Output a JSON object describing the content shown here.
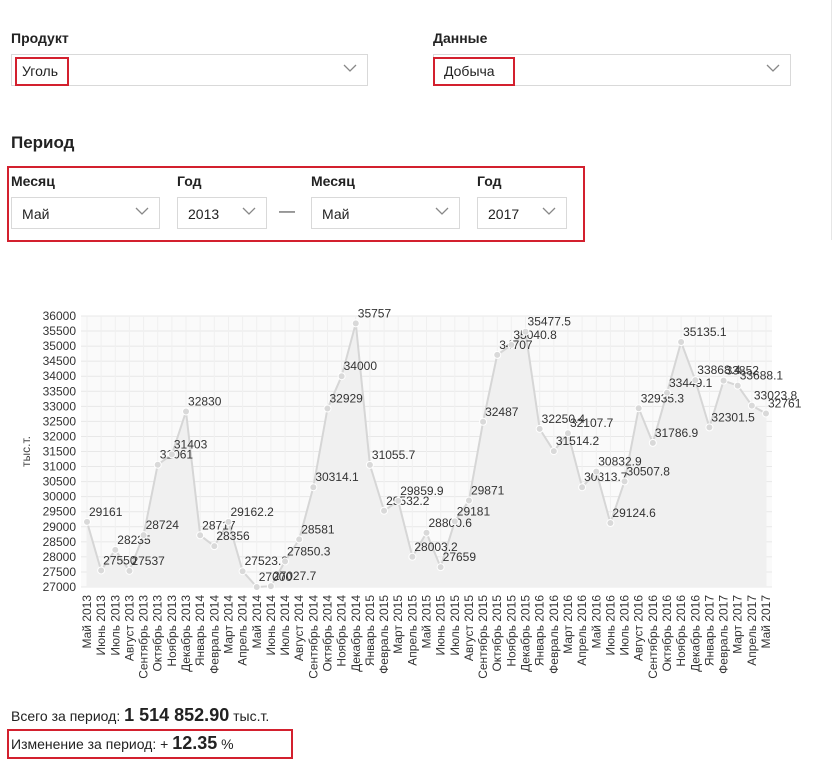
{
  "filters": {
    "product_label": "Продукт",
    "product_value": "Уголь",
    "data_label": "Данные",
    "data_value": "Добыча"
  },
  "period": {
    "title": "Период",
    "month_label": "Месяц",
    "year_label": "Год",
    "from_month": "Май",
    "from_year": "2013",
    "separator": "—",
    "to_month": "Май",
    "to_year": "2017"
  },
  "summary": {
    "total_label": "Всего за период:",
    "total_value": "1 514 852.90",
    "total_unit": "тыс.т.",
    "change_label": "Изменение за период:",
    "change_sign": "+",
    "change_value": "12.35",
    "change_unit": "%"
  },
  "colors": {
    "highlight": "#d3202e",
    "line": "#d6d6d6",
    "area": "#f0f0f0",
    "point": "#d9d9d9",
    "grid": "#e8e8e8"
  },
  "chart_data": {
    "type": "area",
    "ylabel": "тыс.т.",
    "ylim": [
      27000,
      36000
    ],
    "yticks": [
      27000,
      27500,
      28000,
      28500,
      29000,
      29500,
      30000,
      30500,
      31000,
      31500,
      32000,
      32500,
      33000,
      33500,
      34000,
      34500,
      35000,
      35500,
      36000
    ],
    "grid": true,
    "categories": [
      "Май 2013",
      "Июнь 2013",
      "Июль 2013",
      "Август 2013",
      "Сентябрь 2013",
      "Октябрь 2013",
      "Ноябрь 2013",
      "Декабрь 2013",
      "Январь 2014",
      "Февраль 2014",
      "Март 2014",
      "Апрель 2014",
      "Май 2014",
      "Июнь 2014",
      "Июль 2014",
      "Август 2014",
      "Сентябрь 2014",
      "Октябрь 2014",
      "Ноябрь 2014",
      "Декабрь 2014",
      "Январь 2015",
      "Февраль 2015",
      "Март 2015",
      "Апрель 2015",
      "Май 2015",
      "Июнь 2015",
      "Июль 2015",
      "Август 2015",
      "Сентябрь 2015",
      "Октябрь 2015",
      "Ноябрь 2015",
      "Декабрь 2015",
      "Январь 2016",
      "Февраль 2016",
      "Март 2016",
      "Апрель 2016",
      "Май 2016",
      "Июнь 2016",
      "Июль 2016",
      "Август 2016",
      "Сентябрь 2016",
      "Октябрь 2016",
      "Ноябрь 2016",
      "Декабрь 2016",
      "Январь 2017",
      "Февраль 2017",
      "Март 2017",
      "Апрель 2017",
      "Май 2017"
    ],
    "values": [
      29161,
      27550,
      28235,
      27537,
      28724,
      31061,
      31403,
      32830,
      28717,
      28356,
      29162.2,
      27523.8,
      27000,
      27027.7,
      27850.3,
      28581,
      30314.1,
      32929,
      34000,
      35757,
      31055.7,
      29532.2,
      29859.9,
      28003.2,
      28800.6,
      27659,
      29181,
      29871,
      32487,
      34707,
      35040.8,
      35477.5,
      32250.4,
      31514.2,
      32107.7,
      30313.7,
      30832.9,
      29124.6,
      30507.8,
      32935.3,
      31786.9,
      33449.1,
      35135.1,
      33868.4,
      32301.5,
      33852,
      33688.1,
      33023.8,
      32761
    ],
    "labels": [
      "29161",
      "27550",
      "28235",
      "27537",
      "28724",
      "31061",
      "31403",
      "32830",
      "28717",
      "28356",
      "29162.2",
      "27523.8",
      "27000",
      "27027.7",
      "27850.3",
      "28581",
      "30314.1",
      "32929",
      "34000",
      "35757",
      "31055.7",
      "29532.2",
      "29859.9",
      "28003.2",
      "28800.6",
      "27659",
      "29181",
      "29871",
      "32487",
      "34707",
      "35040.8",
      "35477.5",
      "32250.4",
      "31514.2",
      "32107.7",
      "30313.7",
      "30832.9",
      "29124.6",
      "30507.8",
      "32935.3",
      "31786.9",
      "33449.1",
      "35135.1",
      "33868.4",
      "32301.5",
      "33852",
      "33688.1",
      "33023.8",
      "32761"
    ]
  }
}
